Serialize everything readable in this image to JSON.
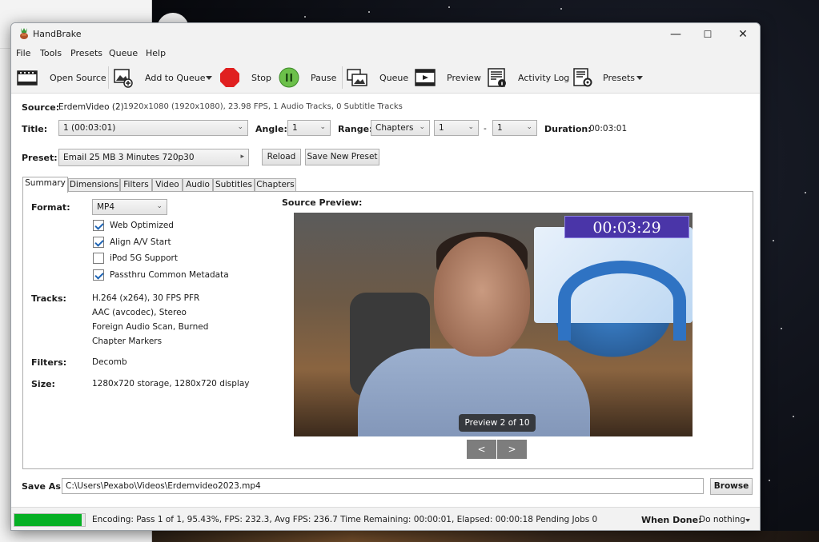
{
  "window": {
    "title": "HandBrake",
    "minimize": "—",
    "maximize": "☐",
    "close": "✕"
  },
  "menu": [
    "File",
    "Tools",
    "Presets",
    "Queue",
    "Help"
  ],
  "toolbar": {
    "open_source": "Open Source",
    "add_to_queue": "Add to Queue",
    "stop": "Stop",
    "pause": "Pause",
    "queue": "Queue",
    "preview": "Preview",
    "activity_log": "Activity Log",
    "presets": "Presets"
  },
  "source": {
    "label": "Source:",
    "name": "ErdemVideo (2)",
    "details": "1920x1080 (1920x1080), 23.98 FPS, 1 Audio Tracks, 0 Subtitle Tracks"
  },
  "title_row": {
    "title_label": "Title:",
    "title_value": "1 (00:03:01)",
    "angle_label": "Angle:",
    "angle_value": "1",
    "range_label": "Range:",
    "range_value": "Chapters",
    "range_start": "1",
    "range_dash": "-",
    "range_end": "1",
    "duration_label": "Duration:",
    "duration_value": "00:03:01"
  },
  "preset": {
    "label": "Preset:",
    "value": "Email 25 MB 3 Minutes 720p30",
    "reload": "Reload",
    "save_new": "Save New Preset"
  },
  "tabs": [
    "Summary",
    "Dimensions",
    "Filters",
    "Video",
    "Audio",
    "Subtitles",
    "Chapters"
  ],
  "summary": {
    "format_label": "Format:",
    "format_value": "MP4",
    "checkboxes": [
      {
        "label": "Web Optimized",
        "checked": true
      },
      {
        "label": "Align A/V Start",
        "checked": true
      },
      {
        "label": "iPod 5G Support",
        "checked": false
      },
      {
        "label": "Passthru Common Metadata",
        "checked": true
      }
    ],
    "tracks_label": "Tracks:",
    "tracks": [
      "H.264 (x264), 30 FPS PFR",
      "AAC (avcodec), Stereo",
      "Foreign Audio Scan, Burned",
      "Chapter Markers"
    ],
    "filters_label": "Filters:",
    "filters_value": "Decomb",
    "size_label": "Size:",
    "size_value": "1280x720 storage, 1280x720 display"
  },
  "preview": {
    "label": "Source Preview:",
    "timestamp": "00:03:29",
    "badge": "Preview 2 of 10",
    "prev": "<",
    "next": ">"
  },
  "save_as": {
    "label": "Save As:",
    "path": "C:\\Users\\Pexabo\\Videos\\Erdemvideo2023.mp4",
    "browse": "Browse"
  },
  "status": {
    "progress_fraction": 0.9543,
    "text": "Encoding: Pass 1 of 1,  95.43%, FPS: 232.3,  Avg FPS: 236.7 Time Remaining: 00:00:01,  Elapsed: 00:00:18   Pending Jobs 0",
    "when_done_label": "When Done:",
    "when_done_value": "Do nothing"
  },
  "colors": {
    "progress": "#06b025",
    "stop": "#e02020",
    "pause": "#6cc04a",
    "timestamp_bg": "#4a35a8"
  }
}
